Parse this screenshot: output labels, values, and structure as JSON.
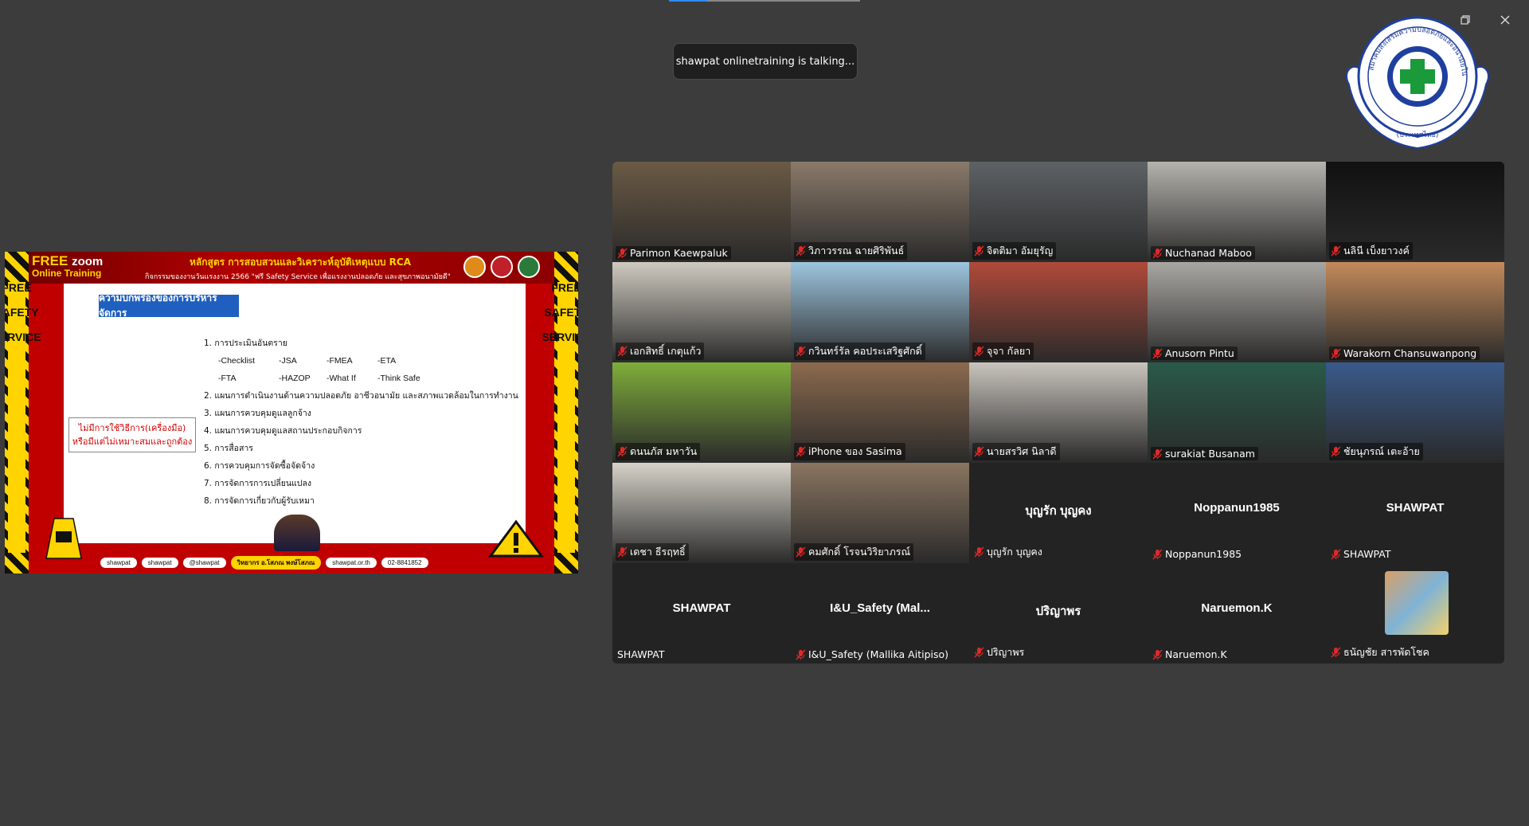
{
  "status_toast": "shawpat onlinetraining is talking...",
  "window_controls": {
    "minimize": "minimize",
    "restore": "restore",
    "close": "close"
  },
  "logo": {
    "text": "สมาคมส่งเสริมความปลอดภัยและอนามัยในการทำงาน (ประเทศไทย)"
  },
  "share": {
    "brand_free": "FREE",
    "brand_zoom": "zoom",
    "brand_training": "Online Training",
    "course_title": "หลักสูตร การสอบสวนและวิเคราะห์อุบัติเหตุแบบ RCA",
    "course_subtitle": "กิจกรรมของงานวันแรงงาน 2566 \"ฟรี Safety Service เพื่อแรงงานปลอดภัย และสุขภาพอนามัยดี\"",
    "side_text": "FREE\n \nSAFETY\n \nSERVICE",
    "slide_title": "ความบกพร่องของการบริหารจัดการ",
    "list": [
      "1. การประเมินอันตราย",
      "2. แผนการดำเนินงานด้านความปลอดภัย อาชีวอนามัย และสภาพแวดล้อมในการทำงาน",
      "3. แผนการควบคุมดูแลลูกจ้าง",
      "4. แผนการควบคุมดูแลสถานประกอบกิจการ",
      "5. การสื่อสาร",
      "6. การควบคุมการจัดซื้อจัดจ้าง",
      "7. การจัดการการเปลี่ยนแปลง",
      "8. การจัดการเกี่ยวกับผู้รับเหมา"
    ],
    "tools_row1": [
      "-Checklist",
      "-JSA",
      "-FMEA",
      "-ETA"
    ],
    "tools_row2": [
      "-FTA",
      "-HAZOP",
      "-What If",
      "-Think Safe"
    ],
    "note_line1": "ไม่มีการใช้วิธีการ(เครื่องมือ)",
    "note_line2": "หรือมีแต่ไม่เหมาะสมและถูกต้อง",
    "footer": [
      "shawpat",
      "shawpat",
      "@shawpat",
      "วิทยากร อ.โสภณ พงษ์โสภณ",
      "shawpat.or.th",
      "02-8841852"
    ]
  },
  "participants": [
    {
      "name": "Parimon Kaewpaluk",
      "type": "video",
      "bg": "#6b5a45"
    },
    {
      "name": "วิภาวรรณ ฉายศิริพันธ์",
      "type": "video",
      "bg": "#8a7a6a"
    },
    {
      "name": "จิตติมา อัมยุรัญ",
      "type": "video",
      "bg": "#5e6266"
    },
    {
      "name": "Nuchanad Maboo",
      "type": "video",
      "bg": "#b5b3ad"
    },
    {
      "name": "นลินี เบ็งยาวงค์",
      "type": "video",
      "bg": "#111111"
    },
    {
      "name": "เอกสิทธิ์ เกตุแก้ว",
      "type": "video",
      "bg": "#cfcac0"
    },
    {
      "name": "กวินทร์รัล คอประเสริฐศักดิ์",
      "type": "video",
      "bg": "#9ec6e0"
    },
    {
      "name": "จุจา กัลยา",
      "type": "video",
      "bg": "#b04a3a"
    },
    {
      "name": "Anusorn Pintu",
      "type": "video",
      "bg": "#a9a7a2"
    },
    {
      "name": "Warakorn Chansuwanpong",
      "type": "video",
      "bg": "#c48a5a"
    },
    {
      "name": "ดนนภัส มหาวัน",
      "type": "video",
      "bg": "#7fae3a"
    },
    {
      "name": "iPhone ของ Sasima",
      "type": "video",
      "bg": "#8c6a4e"
    },
    {
      "name": "นายสรวิศ นิลาดี",
      "type": "video",
      "bg": "#c9c4bd"
    },
    {
      "name": "surakiat Busanam",
      "type": "video",
      "bg": "#2a5a4a"
    },
    {
      "name": "ชัยนุภรณ์ เตะอ้าย",
      "type": "video",
      "bg": "#3a5a8a"
    },
    {
      "name": "เดชา ธีรฤทธิ์",
      "type": "video",
      "bg": "#d6d2c8"
    },
    {
      "name": "คมศักดิ์ โรจนวิริยาภรณ์",
      "type": "video",
      "bg": "#8a7560"
    },
    {
      "name": "บุญรัก บุญคง",
      "type": "name",
      "display": "บุญรัก บุญคง"
    },
    {
      "name": "Noppanun1985",
      "type": "name",
      "display": "Noppanun1985"
    },
    {
      "name": "SHAWPAT",
      "type": "name",
      "display": "SHAWPAT"
    },
    {
      "name": "SHAWPAT",
      "type": "name",
      "display": "SHAWPAT",
      "no_mic": true
    },
    {
      "name": "I&U_Safety (Mallika Aitipiso)",
      "type": "name",
      "display": "I&U_Safety (Mal..."
    },
    {
      "name": "ปริญาพร",
      "type": "name",
      "display": "ปริญาพร"
    },
    {
      "name": "Naruemon.K",
      "type": "name",
      "display": "Naruemon.K"
    },
    {
      "name": "ธนัญชัย สารพัดโชค",
      "type": "avatar"
    }
  ]
}
